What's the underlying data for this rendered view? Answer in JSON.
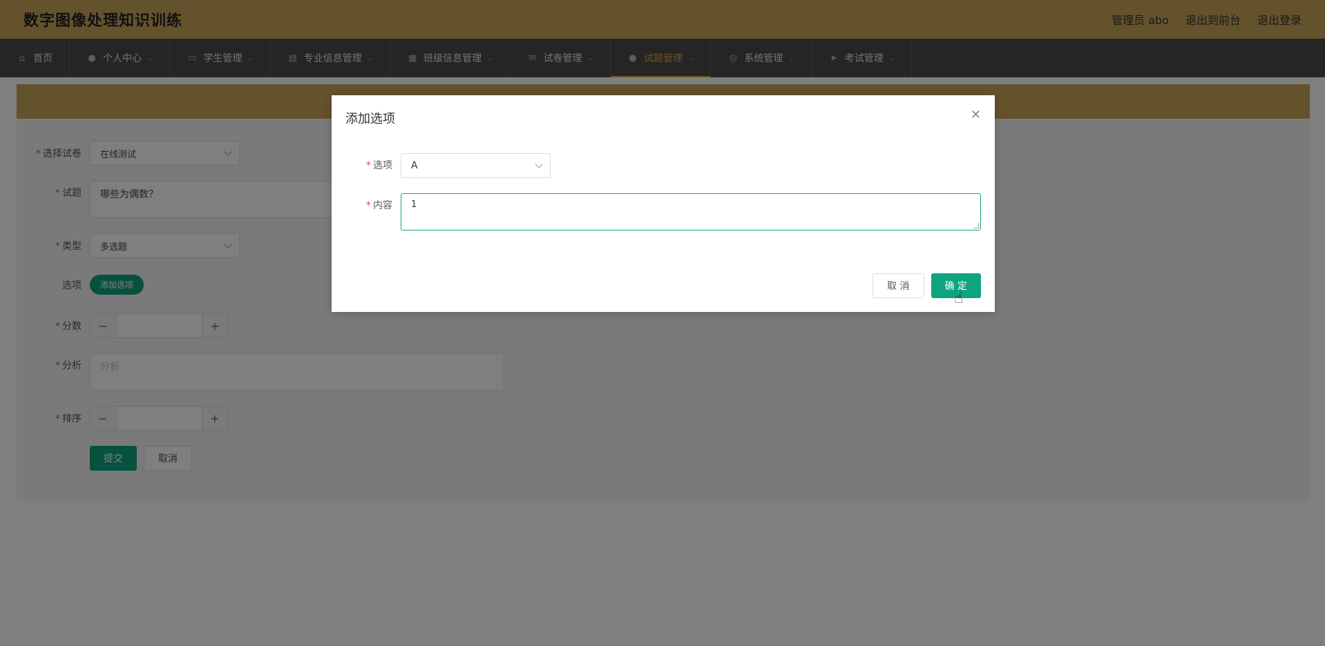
{
  "header": {
    "title": "数字图像处理知识训练",
    "links": [
      "管理员 abo",
      "退出到前台",
      "退出登录"
    ]
  },
  "nav": {
    "items": [
      {
        "label": "首页",
        "icon": "home-icon",
        "dropdown": false,
        "active": false
      },
      {
        "label": "个人中心",
        "icon": "user-icon",
        "dropdown": true,
        "active": false
      },
      {
        "label": "学生管理",
        "icon": "monitor-icon",
        "dropdown": true,
        "active": false
      },
      {
        "label": "专业信息管理",
        "icon": "message-icon",
        "dropdown": true,
        "active": false
      },
      {
        "label": "班级信息管理",
        "icon": "clipboard-icon",
        "dropdown": true,
        "active": false
      },
      {
        "label": "试卷管理",
        "icon": "mail-icon",
        "dropdown": true,
        "active": false
      },
      {
        "label": "试题管理",
        "icon": "user-icon",
        "dropdown": true,
        "active": true
      },
      {
        "label": "系统管理",
        "icon": "compass-icon",
        "dropdown": true,
        "active": false
      },
      {
        "label": "考试管理",
        "icon": "send-icon",
        "dropdown": true,
        "active": false
      }
    ]
  },
  "form": {
    "paper_label": "选择试卷",
    "paper_value": "在线测试",
    "question_label": "试题",
    "question_value": "哪些为偶数？",
    "type_label": "类型",
    "type_value": "多选题",
    "options_label": "选项",
    "add_option_button": "添加选项",
    "score_label": "分数",
    "analysis_label": "分析",
    "analysis_placeholder": "分析",
    "order_label": "排序",
    "submit_button": "提交",
    "cancel_button": "取消"
  },
  "dialog": {
    "title": "添加选项",
    "option_label": "选项",
    "option_value": "A",
    "content_label": "内容",
    "content_value": "1",
    "cancel_button": "取 消",
    "ok_button": "确 定"
  },
  "colors": {
    "header_bg": "#c9a55a",
    "nav_bg": "#4a4a4a",
    "accent": "#10a37f",
    "active_nav": "#d9a73a"
  }
}
